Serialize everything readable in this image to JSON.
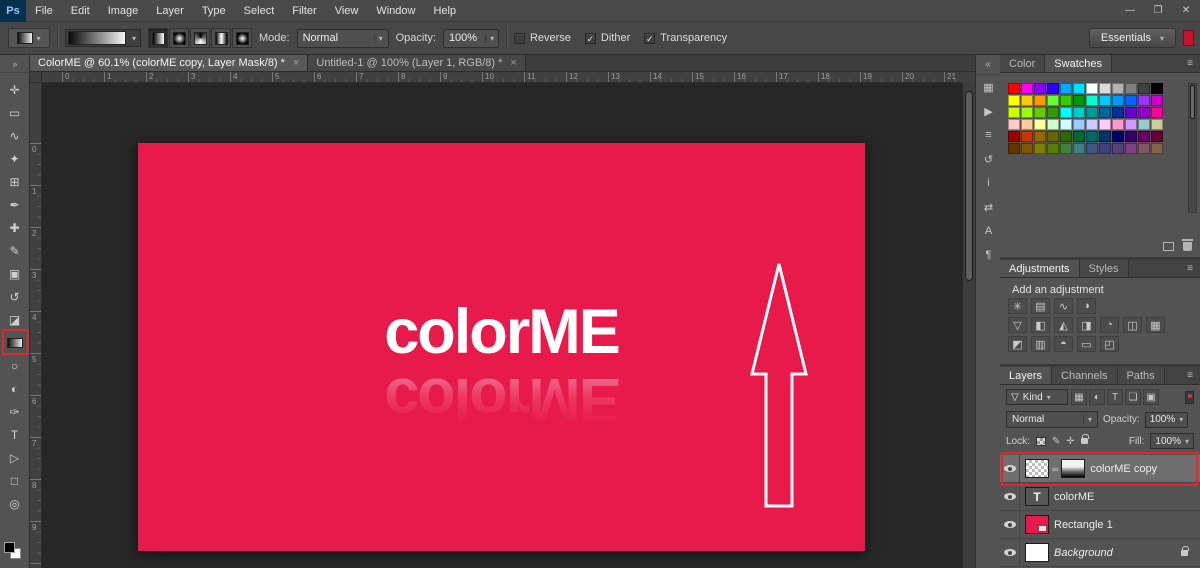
{
  "colors": {
    "canvas_red": "#e8194b",
    "annotation_red": "#e8232a"
  },
  "menubar": {
    "logo": "Ps",
    "items": [
      "File",
      "Edit",
      "Image",
      "Layer",
      "Type",
      "Select",
      "Filter",
      "View",
      "Window",
      "Help"
    ],
    "window_controls": [
      {
        "name": "minimize",
        "glyph": "—"
      },
      {
        "name": "maximize",
        "glyph": "❐"
      },
      {
        "name": "close",
        "glyph": "✕"
      }
    ]
  },
  "options": {
    "gradient_types": [
      {
        "name": "linear-gradient",
        "css": "g-linear",
        "active": true
      },
      {
        "name": "radial-gradient",
        "css": "g-radial",
        "active": false
      },
      {
        "name": "angle-gradient",
        "css": "g-angle",
        "active": false
      },
      {
        "name": "reflected-gradient",
        "css": "g-reflected",
        "active": false
      },
      {
        "name": "diamond-gradient",
        "css": "g-diamond",
        "active": false
      }
    ],
    "mode_label": "Mode:",
    "mode_value": "Normal",
    "opacity_label": "Opacity:",
    "opacity_value": "100%",
    "checks": [
      {
        "name": "reverse",
        "label": "Reverse",
        "checked": false
      },
      {
        "name": "dither",
        "label": "Dither",
        "checked": true
      },
      {
        "name": "transparency",
        "label": "Transparency",
        "checked": true
      }
    ],
    "workspace": "Essentials"
  },
  "tabs": [
    {
      "label": "ColorME @ 60.1% (colorME copy, Layer Mask/8) *",
      "active": true
    },
    {
      "label": "Untitled-1 @ 100% (Layer 1, RGB/8) *",
      "active": false
    }
  ],
  "rulers": {
    "h": [
      "0",
      "1",
      "2",
      "3",
      "4",
      "5",
      "6",
      "7",
      "8",
      "9",
      "10",
      "11",
      "12",
      "13",
      "14",
      "15",
      "16",
      "17",
      "18",
      "19",
      "20",
      "21"
    ],
    "v": [
      "0",
      "1",
      "2",
      "3",
      "4",
      "5",
      "6",
      "7",
      "8",
      "9"
    ]
  },
  "toolbar": {
    "collapse_glyph": "»",
    "tools": [
      {
        "name": "move-tool",
        "glyph": "✛"
      },
      {
        "name": "marquee-tool",
        "glyph": "▭"
      },
      {
        "name": "lasso-tool",
        "glyph": "∿"
      },
      {
        "name": "quick-selection-tool",
        "glyph": "✦"
      },
      {
        "name": "crop-tool",
        "glyph": "⊞"
      },
      {
        "name": "eyedropper-tool",
        "glyph": "✒"
      },
      {
        "name": "healing-brush-tool",
        "glyph": "✚"
      },
      {
        "name": "brush-tool",
        "glyph": "✎"
      },
      {
        "name": "clone-stamp-tool",
        "glyph": "▣"
      },
      {
        "name": "history-brush-tool",
        "glyph": "↺"
      },
      {
        "name": "eraser-tool",
        "glyph": "◪"
      },
      {
        "name": "gradient-tool",
        "glyph": ""
      },
      {
        "name": "blur-tool",
        "glyph": "○"
      },
      {
        "name": "dodge-tool",
        "glyph": "◐"
      },
      {
        "name": "pen-tool",
        "glyph": "✑"
      },
      {
        "name": "type-tool",
        "glyph": "T"
      },
      {
        "name": "path-selection-tool",
        "glyph": "▷"
      },
      {
        "name": "rectangle-tool",
        "glyph": "□"
      },
      {
        "name": "zoom-tool",
        "glyph": "◎"
      }
    ]
  },
  "collapsed_panels": [
    {
      "name": "color-panel-icon",
      "glyph": "▦"
    },
    {
      "name": "actions-panel-icon",
      "glyph": "▶"
    },
    {
      "name": "properties-panel-icon",
      "glyph": "≡"
    },
    {
      "name": "history-panel-icon",
      "glyph": "↺"
    },
    {
      "name": "info-panel-icon",
      "glyph": "i"
    },
    {
      "name": "timeline-panel-icon",
      "glyph": "⇄"
    },
    {
      "name": "character-panel-icon",
      "glyph": "A"
    },
    {
      "name": "paragraph-panel-icon",
      "glyph": "¶"
    }
  ],
  "canvas": {
    "brand_lower": "color",
    "brand_upper": "ME",
    "zoom": "60.1%"
  },
  "panels": {
    "color": {
      "tabs": [
        "Color",
        "Swatches"
      ],
      "active_tab": 1,
      "swatches": [
        [
          "#ff0000",
          "#ff00ff",
          "#8a00ff",
          "#2b00ff",
          "#00a8ff",
          "#00e0ff",
          "#ffffff",
          "#d9d9d9",
          "#b3b3b3",
          "#808080",
          "#404040",
          "#000000"
        ],
        [
          "#ffff00",
          "#ffcc00",
          "#ff9900",
          "#66ff33",
          "#33cc00",
          "#009900",
          "#00ffcc",
          "#00ccff",
          "#0099ff",
          "#0066ff",
          "#9933ff",
          "#cc00cc"
        ],
        [
          "#ccff00",
          "#99ff00",
          "#66cc00",
          "#339900",
          "#00ffff",
          "#00cccc",
          "#009999",
          "#006699",
          "#003399",
          "#6600cc",
          "#9900cc",
          "#ff0099"
        ],
        [
          "#ffcccc",
          "#ffcc99",
          "#ffff99",
          "#ccffcc",
          "#ccffff",
          "#99ccff",
          "#ccccff",
          "#ffccff",
          "#ff99cc",
          "#cc99ff",
          "#99cccc",
          "#cccc99"
        ],
        [
          "#990000",
          "#cc3300",
          "#996600",
          "#666600",
          "#336600",
          "#006633",
          "#006666",
          "#003366",
          "#000066",
          "#330066",
          "#660066",
          "#660033"
        ],
        [
          "#663300",
          "#805500",
          "#808000",
          "#558000",
          "#408040",
          "#408080",
          "#405580",
          "#404080",
          "#554080",
          "#804080",
          "#805566",
          "#806640"
        ]
      ]
    },
    "adjustments": {
      "tabs": [
        "Adjustments",
        "Styles"
      ],
      "active_tab": 0,
      "heading": "Add an adjustment",
      "icon_rows": [
        [
          {
            "name": "brightness-contrast-icon",
            "glyph": "✳"
          },
          {
            "name": "levels-icon",
            "glyph": "▤"
          },
          {
            "name": "curves-icon",
            "glyph": "∿"
          },
          {
            "name": "exposure-icon",
            "glyph": "◑"
          }
        ],
        [
          {
            "name": "vibrance-icon",
            "glyph": "▽"
          },
          {
            "name": "hue-saturation-icon",
            "glyph": "◧"
          },
          {
            "name": "color-balance-icon",
            "glyph": "◭"
          },
          {
            "name": "black-white-icon",
            "glyph": "◨"
          },
          {
            "name": "photo-filter-icon",
            "glyph": "◔"
          },
          {
            "name": "channel-mixer-icon",
            "glyph": "◫"
          },
          {
            "name": "color-lookup-icon",
            "glyph": "▦"
          }
        ],
        [
          {
            "name": "invert-icon",
            "glyph": "◩"
          },
          {
            "name": "posterize-icon",
            "glyph": "▥"
          },
          {
            "name": "threshold-icon",
            "glyph": "◓"
          },
          {
            "name": "gradient-map-icon",
            "glyph": "▭"
          },
          {
            "name": "selective-color-icon",
            "glyph": "◰"
          }
        ]
      ]
    },
    "layers": {
      "tabs": [
        "Layers",
        "Channels",
        "Paths"
      ],
      "active_tab": 0,
      "kind_icon": "▽",
      "kind_label": "Kind",
      "filter_icons": [
        {
          "name": "filter-pixel-icon",
          "glyph": "▦"
        },
        {
          "name": "filter-adjustment-icon",
          "glyph": "◐"
        },
        {
          "name": "filter-type-icon",
          "glyph": "T"
        },
        {
          "name": "filter-shape-icon",
          "glyph": "❏"
        },
        {
          "name": "filter-smart-object-icon",
          "glyph": "▣"
        }
      ],
      "blend_mode": "Normal",
      "opacity_label": "Opacity:",
      "opacity_value": "100%",
      "lock_label": "Lock:",
      "lock_icons": [
        {
          "name": "lock-image-icon",
          "glyph": "✎"
        },
        {
          "name": "lock-position-icon",
          "glyph": "✛"
        }
      ],
      "fill_label": "Fill:",
      "fill_value": "100%",
      "items": [
        {
          "name": "colorME copy",
          "thumb": "checker",
          "has_mask": true,
          "selected": true,
          "italic": false,
          "locked": false
        },
        {
          "name": "colorME",
          "thumb": "text",
          "has_mask": false,
          "selected": false,
          "italic": false,
          "locked": false
        },
        {
          "name": "Rectangle 1",
          "thumb": "shape",
          "has_mask": false,
          "selected": false,
          "italic": false,
          "locked": false
        },
        {
          "name": "Background",
          "thumb": "background",
          "has_mask": false,
          "selected": false,
          "italic": true,
          "locked": true
        }
      ]
    }
  }
}
